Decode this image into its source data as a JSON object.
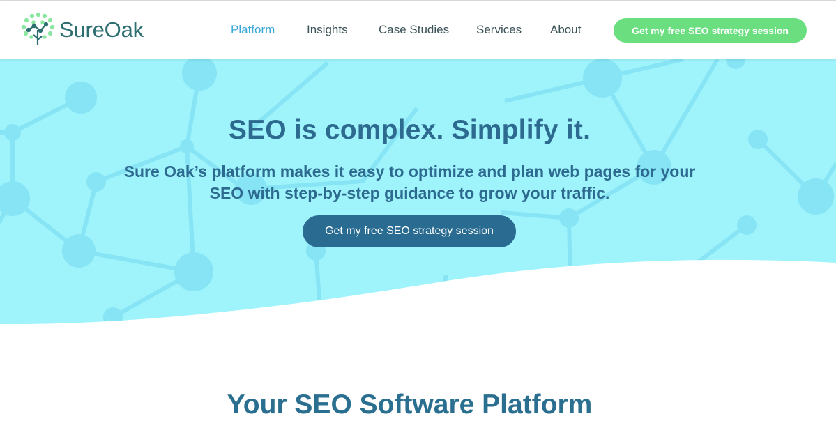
{
  "brand": {
    "name": "SureOak"
  },
  "nav": {
    "items": [
      {
        "label": "Platform",
        "active": true
      },
      {
        "label": "Insights",
        "active": false
      },
      {
        "label": "Case Studies",
        "active": false
      },
      {
        "label": "Services",
        "active": false
      },
      {
        "label": "About",
        "active": false
      }
    ],
    "cta_label": "Get my free SEO strategy session"
  },
  "hero": {
    "title": "SEO is complex. Simplify it.",
    "subtitle": "Sure Oak’s platform makes it easy to optimize and plan web pages for your SEO with step-by-step guidance to grow your traffic.",
    "cta_label": "Get my free SEO strategy session"
  },
  "section": {
    "title": "Your SEO Software Platform"
  },
  "colors": {
    "brand_text": "#2d6e71",
    "nav_active": "#3aa7d7",
    "header_cta": "#6bde80",
    "hero_bg": "#9ff3fb",
    "hero_node": "#86e4f4",
    "hero_text": "#2d6a8f",
    "hero_cta": "#2a6b92"
  },
  "icons": {
    "logo": "tree-network-icon"
  }
}
